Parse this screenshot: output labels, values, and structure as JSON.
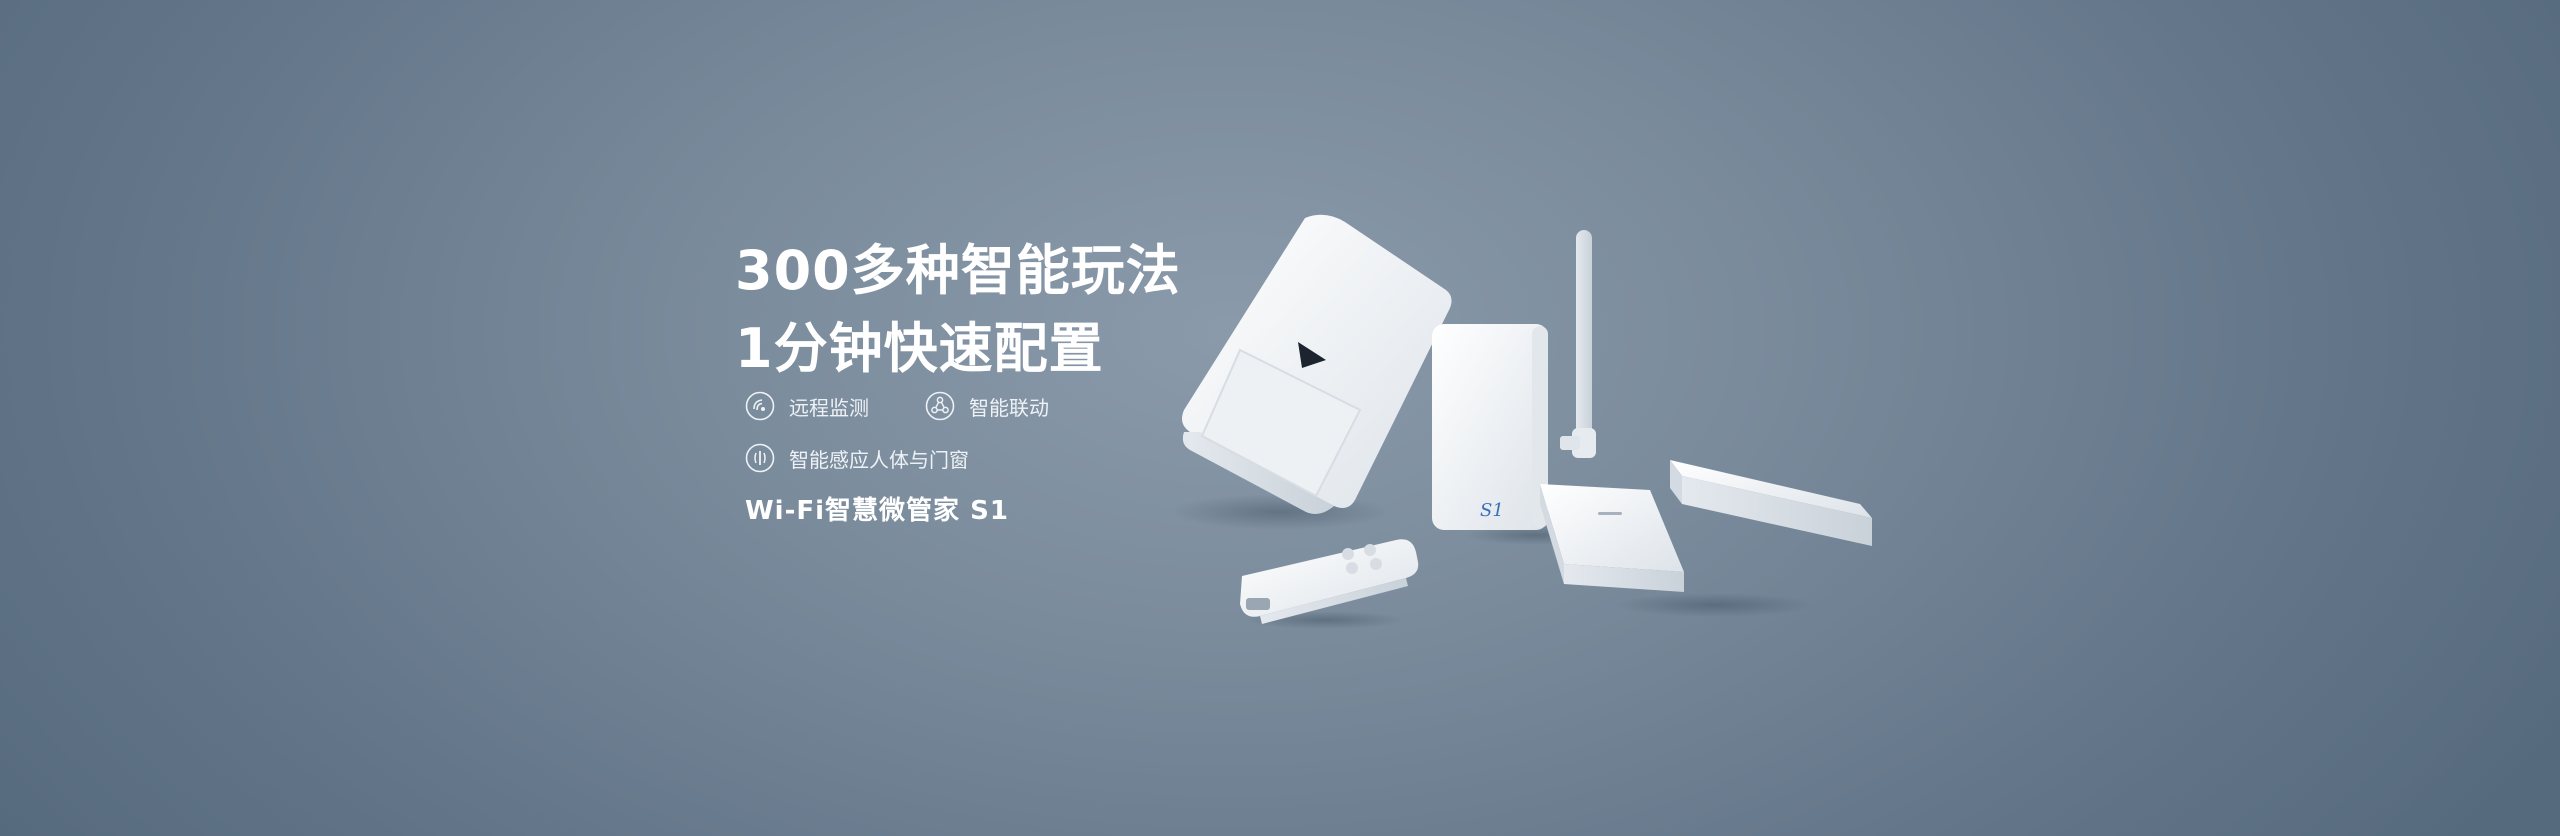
{
  "headline": {
    "line1": "300多种智能玩法",
    "line2": "1分钟快速配置"
  },
  "features": [
    {
      "label": "远程监测",
      "icon": "remote-monitor-icon"
    },
    {
      "label": "智能联动",
      "icon": "smart-link-icon"
    },
    {
      "label": "智能感应人体与门窗",
      "icon": "sensor-icon"
    }
  ],
  "product": {
    "name": "Wi-Fi智慧微管家 S1",
    "hub_mark": "S1"
  },
  "colors": {
    "background": "#7a8b9c",
    "text": "#ffffff",
    "device": "#f4f6f8",
    "hub_mark": "#3a6fb8"
  }
}
